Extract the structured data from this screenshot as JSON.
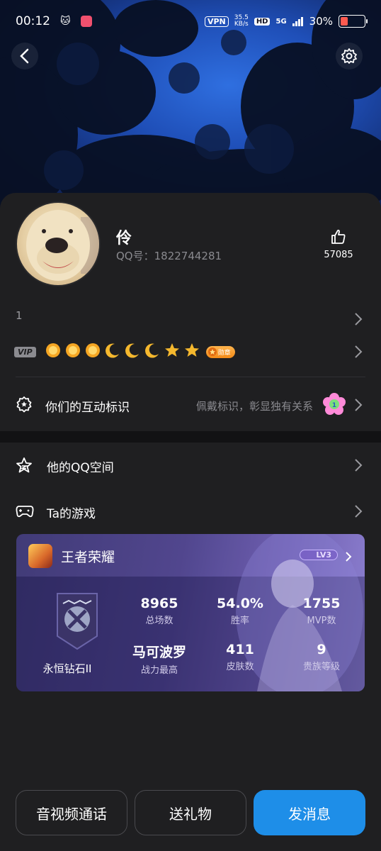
{
  "status_bar": {
    "time": "00:12",
    "vpn": "VPN",
    "speed_value": "35.5",
    "speed_unit": "KB/s",
    "hd": "HD",
    "network": "5G",
    "battery": "30%",
    "icons": [
      "cat-icon",
      "app-icon",
      "signal-icon",
      "battery-icon"
    ]
  },
  "header": {
    "back_icon": "back-arrow-icon",
    "settings_icon": "gear-icon"
  },
  "profile": {
    "nickname": "伶",
    "qq_number": "QQ号：1822744281",
    "like_count": "57085",
    "signature": "1",
    "vip_label": "VIP",
    "medal_label": "勋章",
    "level_icons": [
      "sun-icon",
      "sun-icon",
      "sun-icon",
      "moon-icon",
      "moon-icon",
      "moon-icon",
      "star-icon",
      "star-icon"
    ]
  },
  "interaction": {
    "label": "你们的互动标识",
    "hint": "佩戴标识，彰显独有关系"
  },
  "menu": {
    "qzone": "他的QQ空间",
    "games": "Ta的游戏"
  },
  "game": {
    "title": "王者荣耀",
    "level": "LV3",
    "rank": "永恒钻石II",
    "stats": [
      {
        "value": "8965",
        "label": "总场数"
      },
      {
        "value": "54.0%",
        "label": "胜率"
      },
      {
        "value": "1755",
        "label": "MVP数"
      },
      {
        "value": "马可波罗",
        "label": "战力最高"
      },
      {
        "value": "411",
        "label": "皮肤数"
      },
      {
        "value": "9",
        "label": "贵族等级"
      }
    ]
  },
  "actions": {
    "call": "音视频通话",
    "gift": "送礼物",
    "message": "发消息"
  },
  "colors": {
    "primary_button": "#1e8ee8",
    "background": "#1f1f21"
  }
}
